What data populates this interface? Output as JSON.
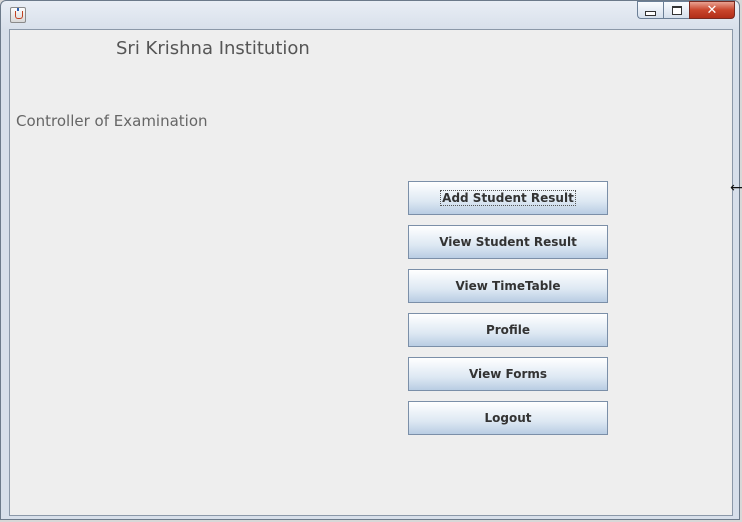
{
  "window": {
    "controls": {
      "minimize": "minimize",
      "maximize": "maximize",
      "close": "✕"
    }
  },
  "header": {
    "institution": "Sri Krishna Institution",
    "role": "Controller of Examination"
  },
  "buttons": [
    {
      "label": "Add Student Result"
    },
    {
      "label": "View Student Result"
    },
    {
      "label": "View TimeTable"
    },
    {
      "label": "Profile"
    },
    {
      "label": "View Forms"
    },
    {
      "label": "Logout"
    }
  ],
  "icons": {
    "app": "java-app-icon",
    "cursor": "horizontal-resize-cursor-icon"
  }
}
